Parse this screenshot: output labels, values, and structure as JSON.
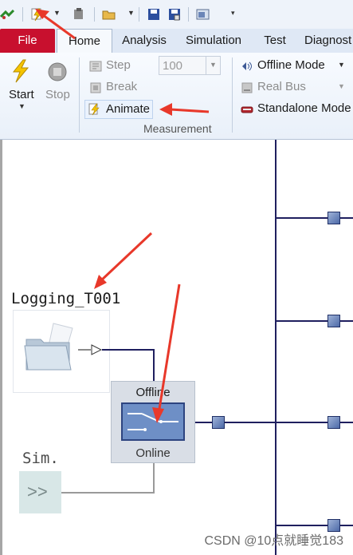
{
  "ribbon_tabs": [
    "File",
    "Home",
    "Analysis",
    "Simulation",
    "Test",
    "Diagnost"
  ],
  "start_group": {
    "start_label": "Start",
    "stop_label": "Stop"
  },
  "measurement_group": {
    "step_label": "Step",
    "step_count": "100",
    "break_label": "Break",
    "animate_label": "Animate",
    "group_label": "Measurement"
  },
  "mode_group": {
    "offline_mode_label": "Offline Mode",
    "real_bus_label": "Real Bus",
    "standalone_mode_label": "Standalone Mode"
  },
  "diagram": {
    "logging_block_label": "Logging_T001",
    "switch_offline_label": "Offline",
    "switch_online_label": "Online",
    "sim_label": "Sim.",
    "sim_symbol": ">>"
  },
  "watermark": "CSDN @10点就睡觉183",
  "colors": {
    "file_tab": "#c8102e",
    "bus_line": "#1f1f5f",
    "annotation_arrow": "#e8382a"
  }
}
